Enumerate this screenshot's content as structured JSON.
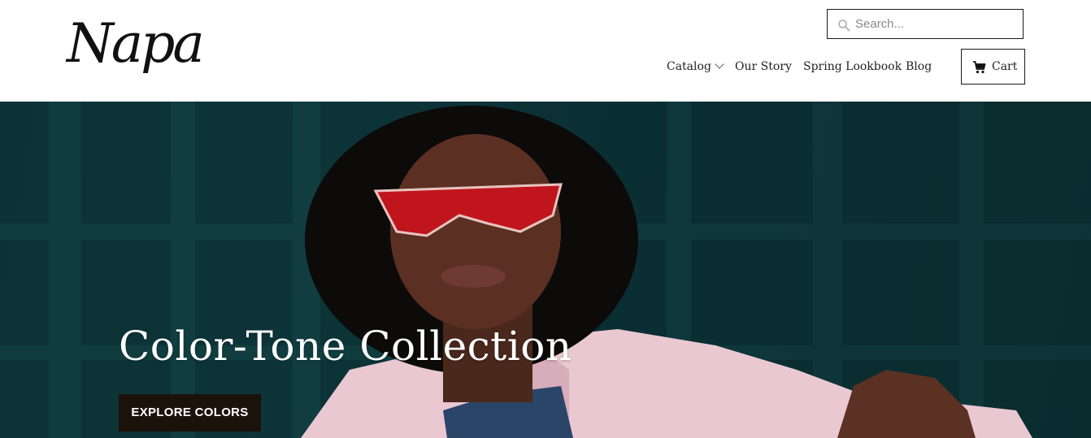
{
  "brand": {
    "logo_text": "Napa"
  },
  "search": {
    "placeholder": "Search..."
  },
  "nav": {
    "items": [
      {
        "label": "Catalog"
      },
      {
        "label": "Our Story"
      },
      {
        "label": "Spring Lookbook"
      },
      {
        "label": "Blog"
      }
    ]
  },
  "cart": {
    "label": "Cart"
  },
  "hero": {
    "title": "Color-Tone Collection",
    "cta_label": "EXPLORE COLORS"
  },
  "icons": {
    "search": "search-icon",
    "chevron": "chevron-down-icon",
    "cart": "cart-icon"
  },
  "colors": {
    "hero_background": "#0f3a3f",
    "cta_background": "#1c120c",
    "sunglasses": "#c0151c",
    "coat": "#e9c8d2"
  }
}
